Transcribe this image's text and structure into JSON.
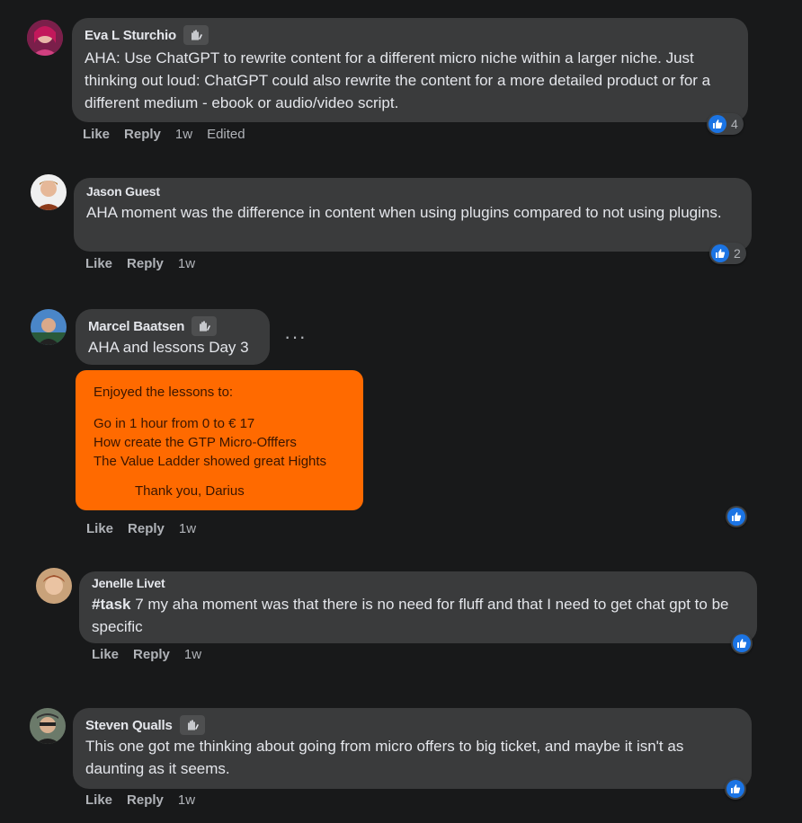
{
  "comments": [
    {
      "author": "Eva L Sturchio",
      "badge": "wave-badge-icon",
      "text": "AHA: Use ChatGPT to rewrite content for a different micro niche within a larger niche. Just thinking out loud: ChatGPT could also rewrite the content for a more detailed product or for a different medium - ebook or audio/video script.",
      "like": "Like",
      "reply": "Reply",
      "time": "1w",
      "edited": "Edited",
      "reactions": "4"
    },
    {
      "author": "Jason Guest",
      "text": "AHA moment was the difference in content when using plugins compared to not using plugins.",
      "like": "Like",
      "reply": "Reply",
      "time": "1w",
      "reactions": "2"
    },
    {
      "author": "Marcel Baatsen",
      "badge": "wave-badge-icon",
      "text": "AHA and lessons Day 3",
      "more": "···",
      "attachment": {
        "heading": "Enjoyed the lessons to:",
        "lines": [
          "Go in 1 hour from 0 to € 17",
          "How create the GTP Micro-Offfers",
          "The Value Ladder showed great Hights"
        ],
        "signature": "Thank you, Darius",
        "background": "#ff6a00"
      },
      "like": "Like",
      "reply": "Reply",
      "time": "1w"
    },
    {
      "author": "Jenelle Livet",
      "hashtag": "#task",
      "text": " 7 my aha moment was that there is no need for fluff and that I need to get chat gpt to be specific",
      "like": "Like",
      "reply": "Reply",
      "time": "1w"
    },
    {
      "author": "Steven Qualls",
      "badge": "wave-badge-icon",
      "text": "This one got me thinking about going from micro offers to big ticket, and maybe it isn't as daunting as it seems.",
      "like": "Like",
      "reply": "Reply",
      "time": "1w"
    }
  ],
  "colors": {
    "background": "#18191a",
    "bubble": "#3a3b3c",
    "like_blue": "#1b74e4",
    "secondary_text": "#b0b3b8"
  }
}
